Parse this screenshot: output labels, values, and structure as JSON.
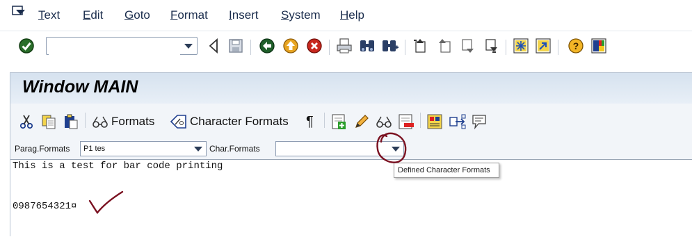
{
  "menu": {
    "items": [
      {
        "label": "Text",
        "mnemonic": "T",
        "rest": "ext"
      },
      {
        "label": "Edit",
        "mnemonic": "E",
        "rest": "dit"
      },
      {
        "label": "Goto",
        "mnemonic": "G",
        "rest": "oto"
      },
      {
        "label": "Format",
        "mnemonic": "F",
        "rest": "ormat"
      },
      {
        "label": "Insert",
        "mnemonic": "I",
        "rest": "nsert"
      },
      {
        "label": "System",
        "mnemonic": "S",
        "rest": "ystem"
      },
      {
        "label": "Help",
        "mnemonic": "H",
        "rest": "elp"
      }
    ]
  },
  "toolbar": {
    "command_field_value": "",
    "icons": [
      "enter-check-icon",
      "back-triangle-icon",
      "save-icon",
      "back-icon",
      "exit-icon",
      "cancel-icon",
      "print-icon",
      "find-icon",
      "find-next-icon",
      "first-page-icon",
      "previous-page-icon",
      "next-page-icon",
      "last-page-icon",
      "new-session-icon",
      "shortcut-icon",
      "help-icon",
      "customize-layout-icon"
    ]
  },
  "window": {
    "title": "Window MAIN"
  },
  "editor_toolbar": {
    "formats_label": "Formats",
    "character_formats_label": "Character Formats",
    "paragraph_mark": "¶"
  },
  "format_row": {
    "parag_formats_label": "Parag.Formats",
    "parag_formats_value": "P1 tes",
    "char_formats_label": "Char.Formats",
    "char_formats_value": ""
  },
  "editor": {
    "line1": "This is a test for bar code printing",
    "line2": "0987654321¤"
  },
  "tooltip": {
    "text": "Defined Character Formats"
  },
  "annotation_color": "#7a1020"
}
